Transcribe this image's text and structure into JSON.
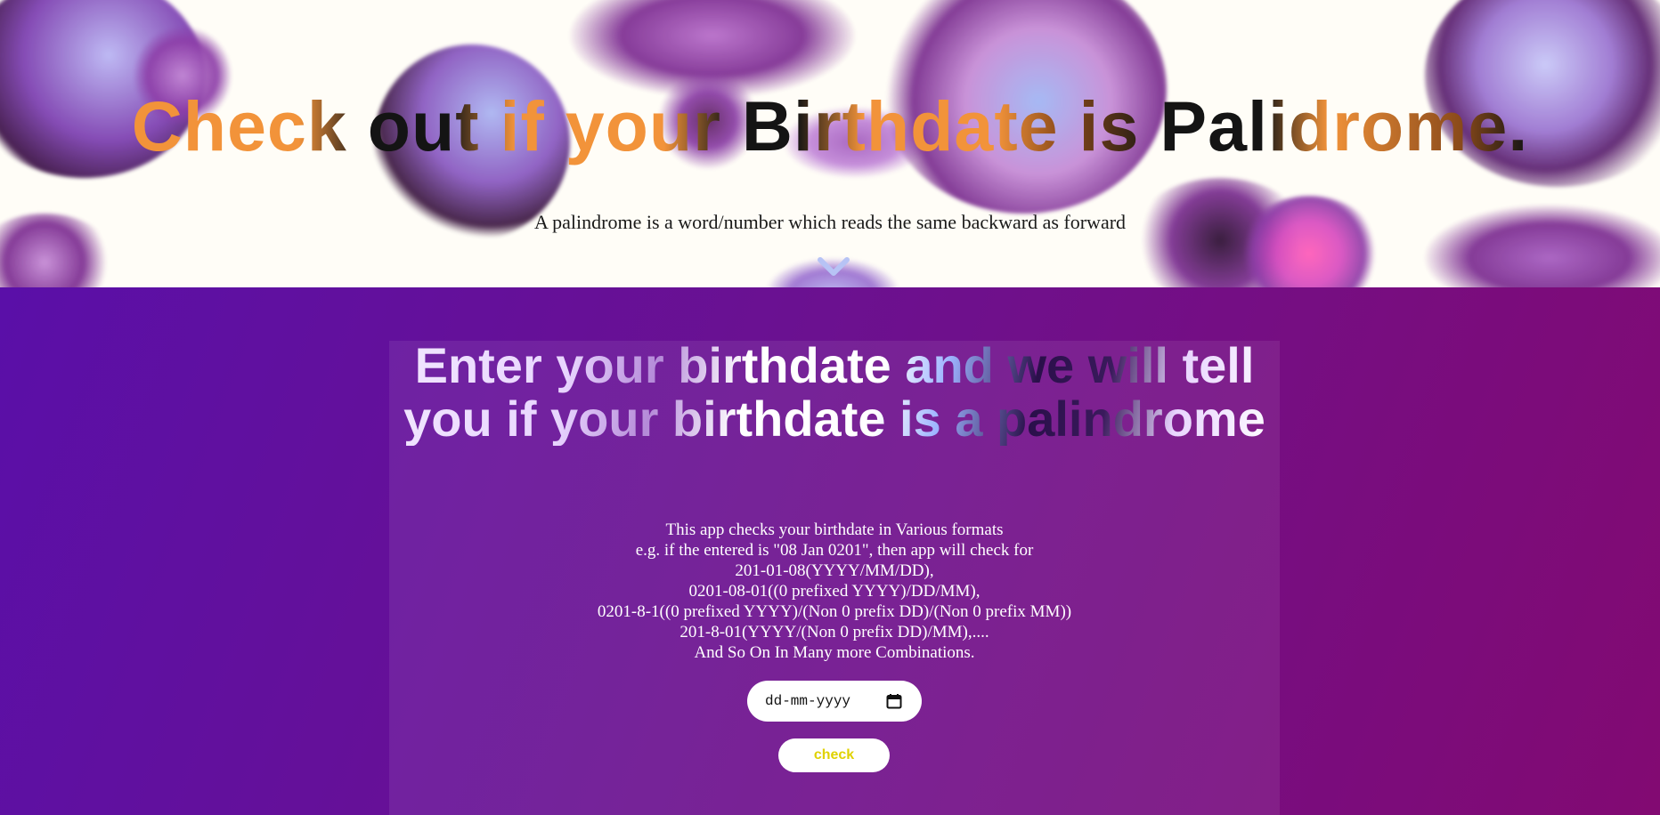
{
  "hero": {
    "title": "Check out if your Birthdate is Palidrome.",
    "subtitle": "A palindrome is a word/number which reads the same backward as forward",
    "scroll_icon": "chevron-down-icon"
  },
  "main": {
    "heading": "Enter your birthdate and we will tell you if your birthdate is a palindrome",
    "description": [
      "This app checks your birthdate in Various formats",
      "e.g. if the entered is \"08 Jan 0201\", then app will check for",
      "201-01-08(YYYY/MM/DD),",
      "0201-08-01((0 prefixed YYYY)/DD/MM),",
      "0201-8-1((0 prefixed YYYY)/(Non 0 prefix DD)/(Non 0 prefix MM))",
      "201-8-01(YYYY/(Non 0 prefix DD)/MM),....",
      "And So On In Many more Combinations."
    ],
    "date_input": {
      "placeholder": "dd-mm-yyyy",
      "icon": "calendar-icon"
    },
    "check_label": "check"
  },
  "colors": {
    "title_orange": "#f2933a",
    "title_dark": "#141414",
    "bg_purple_start": "#5a0fa8",
    "bg_purple_end": "#820a72",
    "button_text": "#e0d200"
  }
}
